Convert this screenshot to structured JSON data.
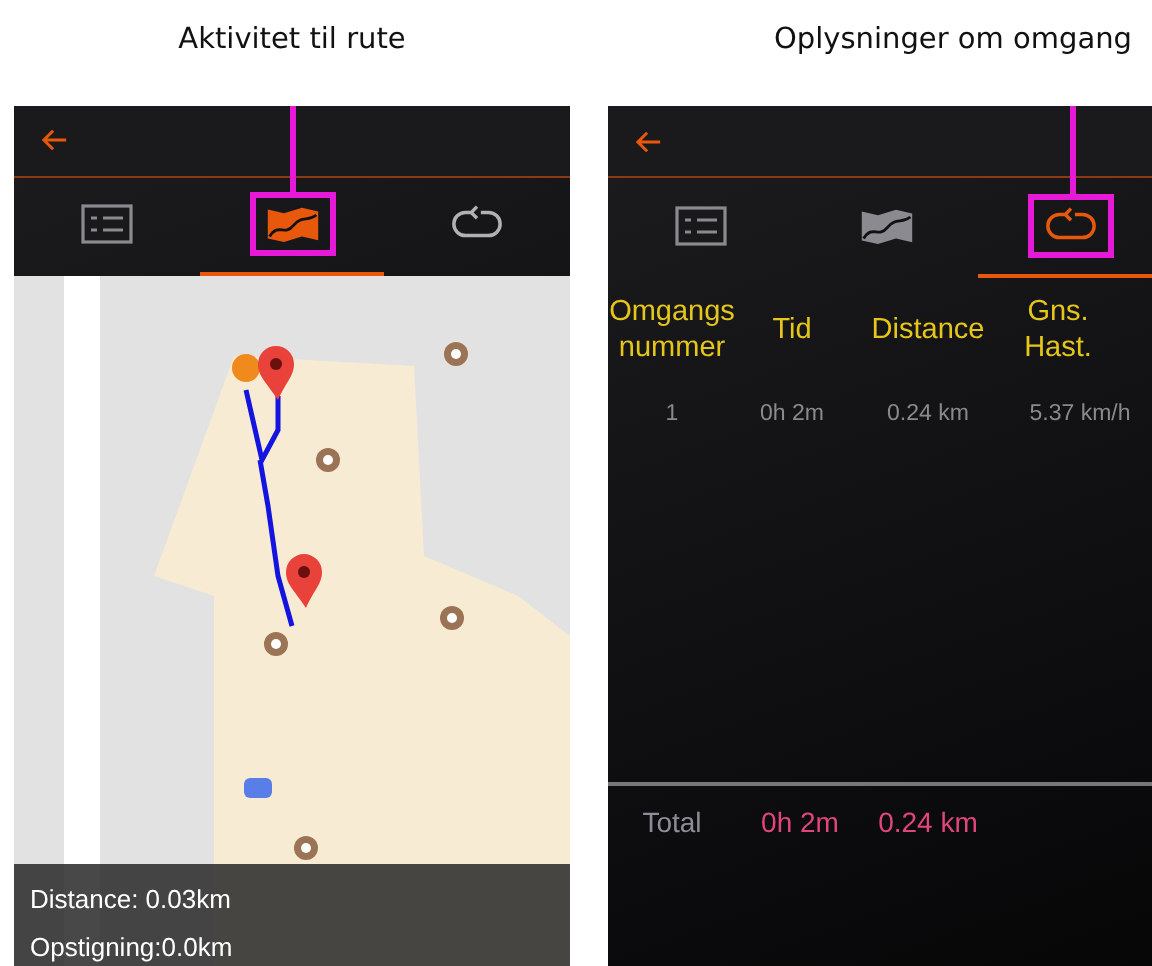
{
  "screens": [
    {
      "kind": "map",
      "caption": "Aktivitet til rute",
      "tabs": [
        {
          "selected": false,
          "highlighted": false
        },
        {
          "selected": true,
          "highlighted": true
        },
        {
          "selected": false,
          "highlighted": false
        }
      ],
      "overlay": [
        "Distance: 0.03km",
        "Opstigning:0.0km"
      ]
    },
    {
      "kind": "laps",
      "caption": "Oplysninger om omgang",
      "tabs": [
        {
          "selected": false,
          "highlighted": false
        },
        {
          "selected": false,
          "highlighted": false
        },
        {
          "selected": true,
          "highlighted": true
        }
      ],
      "columns": [
        "Omgangs nummer",
        "Tid",
        "Distance",
        "Gns. Hast."
      ],
      "rows": [
        [
          "1",
          "0h 2m",
          "0.24 km",
          "5.37 km/h"
        ]
      ],
      "total": {
        "label": "Total",
        "values": [
          "0h 2m",
          "0.24 km"
        ]
      }
    }
  ]
}
